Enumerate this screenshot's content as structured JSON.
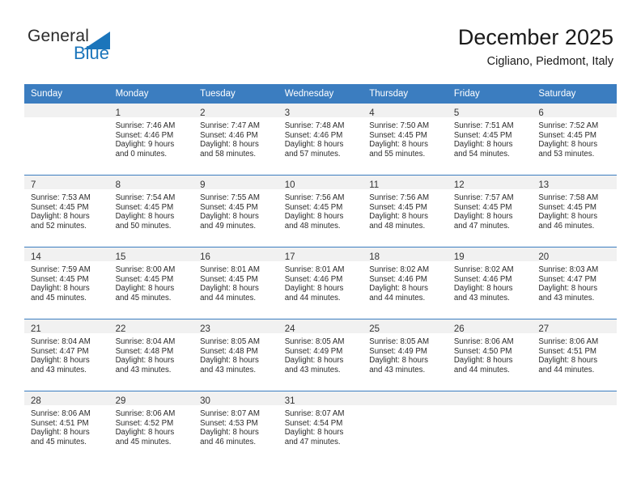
{
  "brand": {
    "name_part1": "General",
    "name_part2": "Blue",
    "triangle_color": "#1b75bb",
    "accent_color": "#1b75bb"
  },
  "header": {
    "title": "December 2025",
    "subtitle": "Cigliano, Piedmont, Italy"
  },
  "theme": {
    "header_row_bg": "#3b7dc0",
    "daynum_band_bg": "#f1f1f1",
    "cell_bg": "#ffffff",
    "text_color": "#2b2b2b"
  },
  "weekday_headers": [
    "Sunday",
    "Monday",
    "Tuesday",
    "Wednesday",
    "Thursday",
    "Friday",
    "Saturday"
  ],
  "weeks": [
    [
      {
        "day": "",
        "sunrise": "",
        "sunset": "",
        "daylight1": "",
        "daylight2": "",
        "empty": true
      },
      {
        "day": "1",
        "sunrise": "Sunrise: 7:46 AM",
        "sunset": "Sunset: 4:46 PM",
        "daylight1": "Daylight: 9 hours",
        "daylight2": "and 0 minutes."
      },
      {
        "day": "2",
        "sunrise": "Sunrise: 7:47 AM",
        "sunset": "Sunset: 4:46 PM",
        "daylight1": "Daylight: 8 hours",
        "daylight2": "and 58 minutes."
      },
      {
        "day": "3",
        "sunrise": "Sunrise: 7:48 AM",
        "sunset": "Sunset: 4:46 PM",
        "daylight1": "Daylight: 8 hours",
        "daylight2": "and 57 minutes."
      },
      {
        "day": "4",
        "sunrise": "Sunrise: 7:50 AM",
        "sunset": "Sunset: 4:45 PM",
        "daylight1": "Daylight: 8 hours",
        "daylight2": "and 55 minutes."
      },
      {
        "day": "5",
        "sunrise": "Sunrise: 7:51 AM",
        "sunset": "Sunset: 4:45 PM",
        "daylight1": "Daylight: 8 hours",
        "daylight2": "and 54 minutes."
      },
      {
        "day": "6",
        "sunrise": "Sunrise: 7:52 AM",
        "sunset": "Sunset: 4:45 PM",
        "daylight1": "Daylight: 8 hours",
        "daylight2": "and 53 minutes."
      }
    ],
    [
      {
        "day": "7",
        "sunrise": "Sunrise: 7:53 AM",
        "sunset": "Sunset: 4:45 PM",
        "daylight1": "Daylight: 8 hours",
        "daylight2": "and 52 minutes."
      },
      {
        "day": "8",
        "sunrise": "Sunrise: 7:54 AM",
        "sunset": "Sunset: 4:45 PM",
        "daylight1": "Daylight: 8 hours",
        "daylight2": "and 50 minutes."
      },
      {
        "day": "9",
        "sunrise": "Sunrise: 7:55 AM",
        "sunset": "Sunset: 4:45 PM",
        "daylight1": "Daylight: 8 hours",
        "daylight2": "and 49 minutes."
      },
      {
        "day": "10",
        "sunrise": "Sunrise: 7:56 AM",
        "sunset": "Sunset: 4:45 PM",
        "daylight1": "Daylight: 8 hours",
        "daylight2": "and 48 minutes."
      },
      {
        "day": "11",
        "sunrise": "Sunrise: 7:56 AM",
        "sunset": "Sunset: 4:45 PM",
        "daylight1": "Daylight: 8 hours",
        "daylight2": "and 48 minutes."
      },
      {
        "day": "12",
        "sunrise": "Sunrise: 7:57 AM",
        "sunset": "Sunset: 4:45 PM",
        "daylight1": "Daylight: 8 hours",
        "daylight2": "and 47 minutes."
      },
      {
        "day": "13",
        "sunrise": "Sunrise: 7:58 AM",
        "sunset": "Sunset: 4:45 PM",
        "daylight1": "Daylight: 8 hours",
        "daylight2": "and 46 minutes."
      }
    ],
    [
      {
        "day": "14",
        "sunrise": "Sunrise: 7:59 AM",
        "sunset": "Sunset: 4:45 PM",
        "daylight1": "Daylight: 8 hours",
        "daylight2": "and 45 minutes."
      },
      {
        "day": "15",
        "sunrise": "Sunrise: 8:00 AM",
        "sunset": "Sunset: 4:45 PM",
        "daylight1": "Daylight: 8 hours",
        "daylight2": "and 45 minutes."
      },
      {
        "day": "16",
        "sunrise": "Sunrise: 8:01 AM",
        "sunset": "Sunset: 4:45 PM",
        "daylight1": "Daylight: 8 hours",
        "daylight2": "and 44 minutes."
      },
      {
        "day": "17",
        "sunrise": "Sunrise: 8:01 AM",
        "sunset": "Sunset: 4:46 PM",
        "daylight1": "Daylight: 8 hours",
        "daylight2": "and 44 minutes."
      },
      {
        "day": "18",
        "sunrise": "Sunrise: 8:02 AM",
        "sunset": "Sunset: 4:46 PM",
        "daylight1": "Daylight: 8 hours",
        "daylight2": "and 44 minutes."
      },
      {
        "day": "19",
        "sunrise": "Sunrise: 8:02 AM",
        "sunset": "Sunset: 4:46 PM",
        "daylight1": "Daylight: 8 hours",
        "daylight2": "and 43 minutes."
      },
      {
        "day": "20",
        "sunrise": "Sunrise: 8:03 AM",
        "sunset": "Sunset: 4:47 PM",
        "daylight1": "Daylight: 8 hours",
        "daylight2": "and 43 minutes."
      }
    ],
    [
      {
        "day": "21",
        "sunrise": "Sunrise: 8:04 AM",
        "sunset": "Sunset: 4:47 PM",
        "daylight1": "Daylight: 8 hours",
        "daylight2": "and 43 minutes."
      },
      {
        "day": "22",
        "sunrise": "Sunrise: 8:04 AM",
        "sunset": "Sunset: 4:48 PM",
        "daylight1": "Daylight: 8 hours",
        "daylight2": "and 43 minutes."
      },
      {
        "day": "23",
        "sunrise": "Sunrise: 8:05 AM",
        "sunset": "Sunset: 4:48 PM",
        "daylight1": "Daylight: 8 hours",
        "daylight2": "and 43 minutes."
      },
      {
        "day": "24",
        "sunrise": "Sunrise: 8:05 AM",
        "sunset": "Sunset: 4:49 PM",
        "daylight1": "Daylight: 8 hours",
        "daylight2": "and 43 minutes."
      },
      {
        "day": "25",
        "sunrise": "Sunrise: 8:05 AM",
        "sunset": "Sunset: 4:49 PM",
        "daylight1": "Daylight: 8 hours",
        "daylight2": "and 43 minutes."
      },
      {
        "day": "26",
        "sunrise": "Sunrise: 8:06 AM",
        "sunset": "Sunset: 4:50 PM",
        "daylight1": "Daylight: 8 hours",
        "daylight2": "and 44 minutes."
      },
      {
        "day": "27",
        "sunrise": "Sunrise: 8:06 AM",
        "sunset": "Sunset: 4:51 PM",
        "daylight1": "Daylight: 8 hours",
        "daylight2": "and 44 minutes."
      }
    ],
    [
      {
        "day": "28",
        "sunrise": "Sunrise: 8:06 AM",
        "sunset": "Sunset: 4:51 PM",
        "daylight1": "Daylight: 8 hours",
        "daylight2": "and 45 minutes."
      },
      {
        "day": "29",
        "sunrise": "Sunrise: 8:06 AM",
        "sunset": "Sunset: 4:52 PM",
        "daylight1": "Daylight: 8 hours",
        "daylight2": "and 45 minutes."
      },
      {
        "day": "30",
        "sunrise": "Sunrise: 8:07 AM",
        "sunset": "Sunset: 4:53 PM",
        "daylight1": "Daylight: 8 hours",
        "daylight2": "and 46 minutes."
      },
      {
        "day": "31",
        "sunrise": "Sunrise: 8:07 AM",
        "sunset": "Sunset: 4:54 PM",
        "daylight1": "Daylight: 8 hours",
        "daylight2": "and 47 minutes."
      },
      {
        "day": "",
        "sunrise": "",
        "sunset": "",
        "daylight1": "",
        "daylight2": "",
        "empty": true
      },
      {
        "day": "",
        "sunrise": "",
        "sunset": "",
        "daylight1": "",
        "daylight2": "",
        "empty": true
      },
      {
        "day": "",
        "sunrise": "",
        "sunset": "",
        "daylight1": "",
        "daylight2": "",
        "empty": true
      }
    ]
  ]
}
